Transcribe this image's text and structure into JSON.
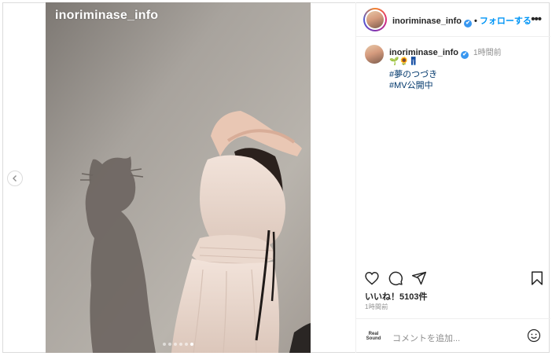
{
  "post": {
    "watermark": "inoriminase_info",
    "carousel": {
      "dot_count": 6,
      "active_index": 5
    }
  },
  "header": {
    "username": "inoriminase_info",
    "verified_mark": "✔",
    "separator": "•",
    "follow_label": "フォローする",
    "more_label": "•••"
  },
  "caption": {
    "username": "inoriminase_info",
    "time": "1時間前",
    "emoji": "🌱🌻👖",
    "hashtags": [
      "#夢のつづき",
      "#MV公開中"
    ]
  },
  "engagement": {
    "likes_text": "いいね！5103件",
    "posted_ago": "1時間前"
  },
  "comment_box": {
    "brand_logo": [
      "Real",
      "Sound"
    ],
    "placeholder": "コメントを追加..."
  },
  "colors": {
    "link_blue": "#0095f6",
    "hashtag_blue": "#00376b",
    "verified_blue": "#3897f0",
    "border": "#dbdbdb"
  },
  "icons": [
    "chevron-left-icon",
    "more-icon",
    "heart-icon",
    "comment-icon",
    "share-icon",
    "bookmark-icon",
    "emoji-icon"
  ]
}
